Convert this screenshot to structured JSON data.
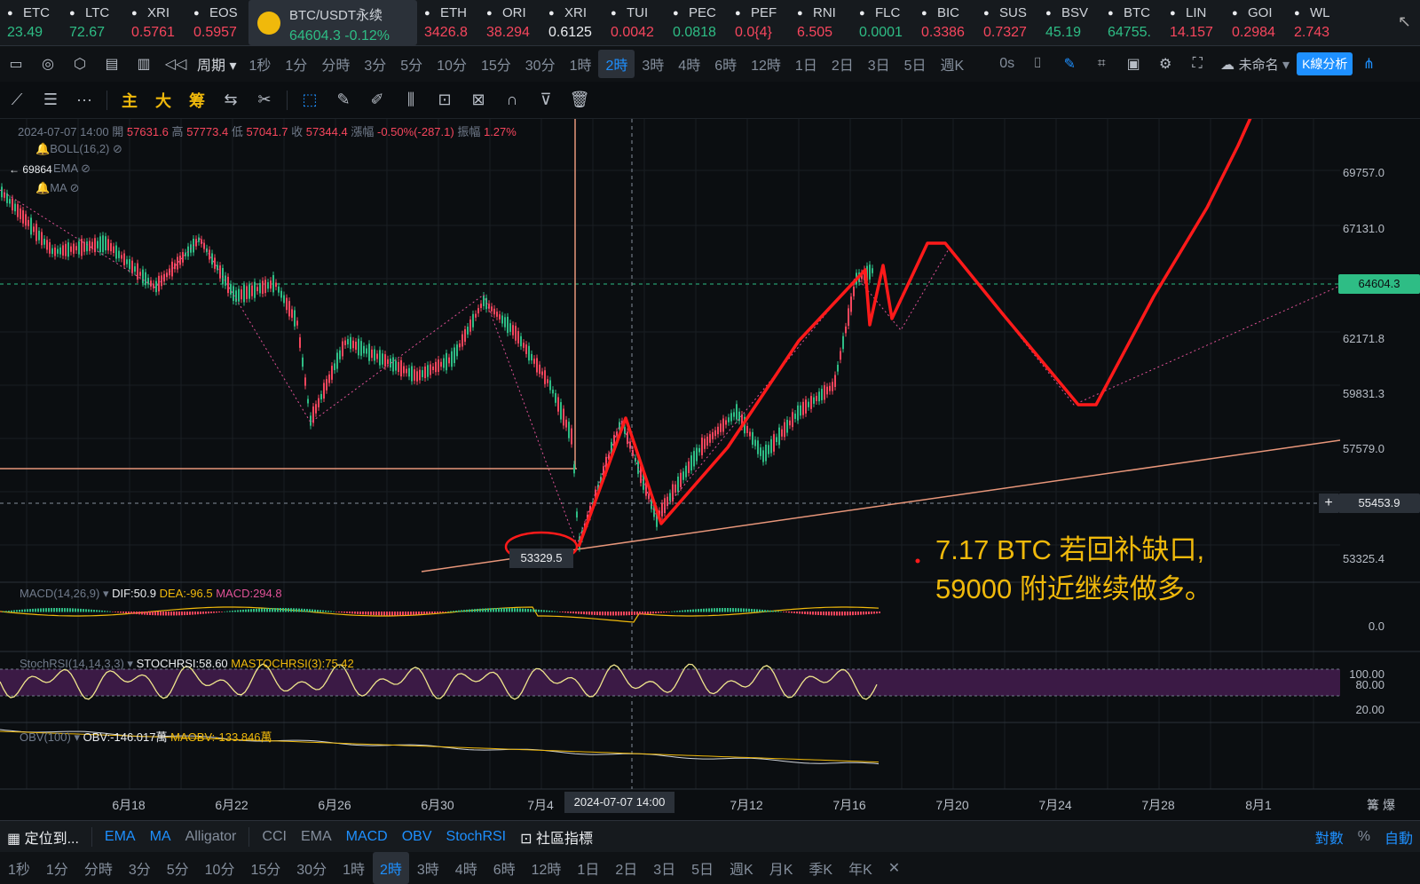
{
  "ticker": {
    "items": [
      {
        "symbol": "ETC",
        "value": "23.49",
        "color": "#2ebd85"
      },
      {
        "symbol": "LTC",
        "value": "72.67",
        "color": "#2ebd85"
      },
      {
        "symbol": "XRI",
        "value": "0.5761",
        "color": "#f6465d"
      },
      {
        "symbol": "EOS",
        "value": "0.5957",
        "color": "#f6465d"
      },
      {
        "symbol": "BTC/USDT永续",
        "value": "64604.3 -0.12%",
        "color": "#2ebd85",
        "active": true
      },
      {
        "symbol": "ETH",
        "value": "3426.8",
        "color": "#f6465d"
      },
      {
        "symbol": "ORI",
        "value": "38.294",
        "color": "#f6465d"
      },
      {
        "symbol": "XRI",
        "value": "0.6125",
        "color": "#eaecef"
      },
      {
        "symbol": "TUI",
        "value": "0.0042",
        "color": "#f6465d"
      },
      {
        "symbol": "PEC",
        "value": "0.0818",
        "color": "#2ebd85"
      },
      {
        "symbol": "PEF",
        "value": "0.0{4}",
        "color": "#f6465d"
      },
      {
        "symbol": "RNI",
        "value": "6.505",
        "color": "#f6465d"
      },
      {
        "symbol": "FLC",
        "value": "0.0001",
        "color": "#2ebd85"
      },
      {
        "symbol": "BIC",
        "value": "0.3386",
        "color": "#f6465d"
      },
      {
        "symbol": "SUS",
        "value": "0.7327",
        "color": "#f6465d"
      },
      {
        "symbol": "BSV",
        "value": "45.19",
        "color": "#2ebd85"
      },
      {
        "symbol": "BTC",
        "value": "64755.",
        "color": "#2ebd85"
      },
      {
        "symbol": "LIN",
        "value": "14.157",
        "color": "#f6465d"
      },
      {
        "symbol": "GOI",
        "value": "0.2984",
        "color": "#f6465d"
      },
      {
        "symbol": "WL",
        "value": "2.743",
        "color": "#f6465d"
      }
    ]
  },
  "period_bar": {
    "period_label": "周期",
    "items": [
      "1秒",
      "1分",
      "分時",
      "3分",
      "5分",
      "10分",
      "15分",
      "30分",
      "1時",
      "2時",
      "3時",
      "4時",
      "6時",
      "12時",
      "1日",
      "2日",
      "3日",
      "5日",
      "週K"
    ],
    "active": "2時",
    "countdown": "0s",
    "layout_name": "未命名",
    "kline_button": "K線分析"
  },
  "draw_bar": {
    "main_label": "主",
    "big_label": "大",
    "chip_label": "筹"
  },
  "chart": {
    "ohlc_line": {
      "date": "2024-07-07 14:00",
      "open_label": "開",
      "open": "57631.6",
      "high_label": "高",
      "high": "57773.4",
      "low_label": "低",
      "low": "57041.7",
      "close_label": "收",
      "close": "57344.4",
      "chg_label": "漲幅",
      "chg": "-0.50%(-287.1)",
      "amp_label": "振幅",
      "amp": "1.27%"
    },
    "overlays": [
      "BOLL(16,2)",
      "EMA",
      "MA"
    ],
    "high_marker": "69864",
    "low_marker": "53329.5",
    "price_axis": [
      "69757.0",
      "67131.0",
      "62171.8",
      "59831.3",
      "57579.0",
      "53325.4"
    ],
    "current_price": "64604.3",
    "crosshair_price": "55453.9",
    "crosshair_date": "2024-07-07 14:00",
    "annotation_line1": "7.17  BTC 若回补缺口,",
    "annotation_line2": "59000 附近继续做多。",
    "macd": {
      "name": "MACD(14,26,9)",
      "dif": "DIF:50.9",
      "dea": "DEA:-96.5",
      "macd": "MACD:294.8",
      "axis": "0.0"
    },
    "stochrsi": {
      "name": "StochRSI(14,14,3,3)",
      "value": "STOCHRSI:58.60",
      "ma": "MASTOCHRSI(3):75.42",
      "axis": [
        "100.00",
        "80.00",
        "20.00"
      ]
    },
    "obv": {
      "name": "OBV(100)",
      "value": "OBV:-146.017萬",
      "ma": "MAOBV:-133.846萬"
    },
    "x_labels": [
      "6月18",
      "6月22",
      "6月26",
      "6月30",
      "7月4",
      "7月12",
      "7月16",
      "7月20",
      "7月24",
      "7月28",
      "8月1"
    ],
    "x_right_label": "篝 爆"
  },
  "indicator_bar": {
    "goto": "定位到...",
    "items": [
      "EMA",
      "MA",
      "Alligator",
      "CCI",
      "EMA",
      "MACD",
      "OBV",
      "StochRSI"
    ],
    "community": "社區指標",
    "log": "對數",
    "pct": "%",
    "auto": "自動"
  },
  "period_bar2": {
    "items": [
      "1秒",
      "1分",
      "分時",
      "3分",
      "5分",
      "10分",
      "15分",
      "30分",
      "1時",
      "2時",
      "3時",
      "4時",
      "6時",
      "12時",
      "1日",
      "2日",
      "3日",
      "5日",
      "週K",
      "月K",
      "季K",
      "年K"
    ],
    "active": "2時"
  }
}
